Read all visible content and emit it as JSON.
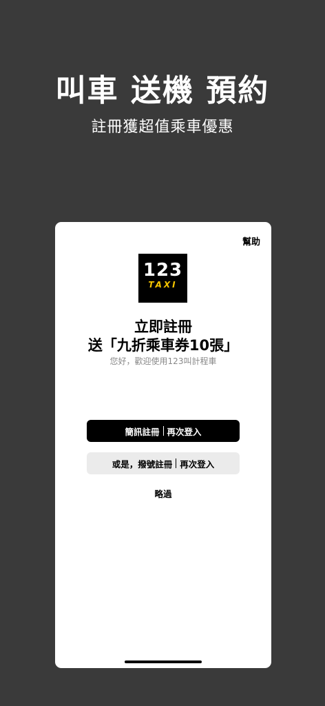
{
  "hero": {
    "title": "叫車 送機 預約",
    "subtitle": "註冊獲超值乘車優惠"
  },
  "card": {
    "help_label": "幫助",
    "logo": {
      "number": "123",
      "word": "TAXI"
    },
    "promo_line1": "立即註冊",
    "promo_line2": "送「九折乘車券10張」",
    "welcome": "您好，歡迎使用123叫計程車",
    "sms_button": {
      "register_label": "簡訊註冊",
      "login_label": "再次登入"
    },
    "alt_button": {
      "register_label": "或是，撥號註冊",
      "login_label": "再次登入"
    },
    "skip_label": "略過"
  },
  "colors": {
    "background": "#3a3a3a",
    "card": "#ffffff",
    "primary_button": "#000000",
    "secondary_button": "#ebebeb",
    "logo_accent": "#f5c400"
  }
}
